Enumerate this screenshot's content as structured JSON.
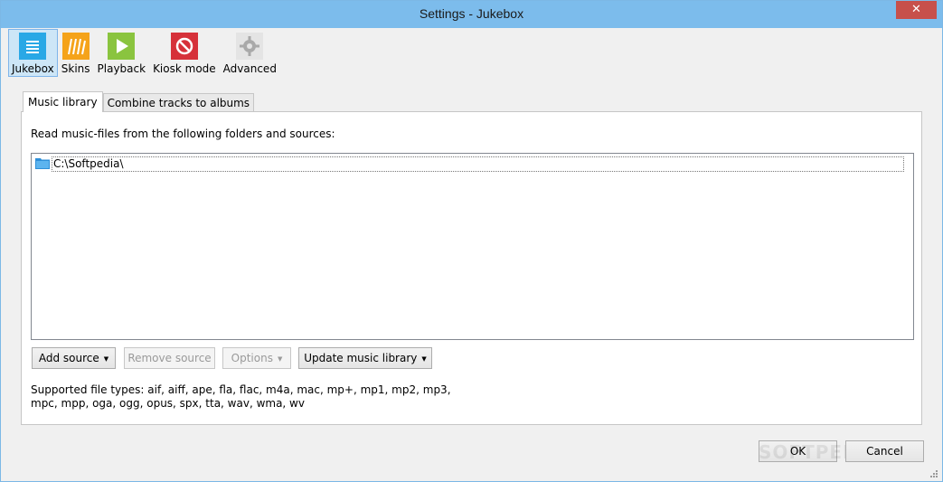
{
  "window": {
    "title": "Settings - Jukebox",
    "close_label": "✕"
  },
  "toolbar": {
    "items": [
      {
        "label": "Jukebox",
        "icon": "list-icon",
        "color": "#29a8e6",
        "active": true
      },
      {
        "label": "Skins",
        "icon": "skins-icon",
        "color": "#f5a31a"
      },
      {
        "label": "Playback",
        "icon": "play-icon",
        "color": "#8ac43f"
      },
      {
        "label": "Kiosk mode",
        "icon": "no-entry-icon",
        "color": "#d6313a"
      },
      {
        "label": "Advanced",
        "icon": "gear-icon",
        "color": "#b8b8b8"
      }
    ]
  },
  "tabs": [
    {
      "label": "Music library",
      "active": true
    },
    {
      "label": "Combine tracks to albums"
    }
  ],
  "music_library": {
    "caption": "Read music-files from the following folders and sources:",
    "sources": [
      "C:\\Softpedia\\"
    ],
    "buttons": {
      "add_source": "Add source",
      "remove_source": "Remove source",
      "options": "Options",
      "update_library": "Update music library"
    },
    "supported_line1": "Supported file types: aif, aiff, ape, fla, flac, m4a, mac, mp+, mp1, mp2, mp3,",
    "supported_line2": "mpc, mpp, oga, ogg, opus, spx, tta, wav, wma, wv"
  },
  "footer": {
    "ok": "OK",
    "cancel": "Cancel",
    "watermark": "SOFTPEDIA"
  }
}
